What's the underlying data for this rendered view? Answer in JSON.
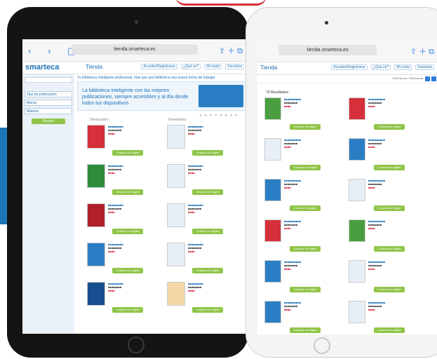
{
  "browser": {
    "url": "tienda.smarteca.es",
    "nav_glyphs": "‹ › ▢",
    "icons": [
      "reload-icon",
      "share-icon",
      "new-tab-icon",
      "tabs-icon"
    ]
  },
  "site": {
    "logo": "smarteca",
    "section": "Tienda",
    "head_links": [
      "Acceder/Registrarse",
      "¿Qué es?",
      "Mi cesta",
      "Favoritos"
    ],
    "tagline": "Tu biblioteca inteligente profesional, más que una biblioteca una nueva forma de trabajar"
  },
  "sidebar": {
    "filters": [
      "Tipo de publicación",
      "Marca",
      "Materia"
    ],
    "go_label": "Buscar"
  },
  "banner": {
    "text": "La biblioteca inteligente con las mejores publicaciones, siempre accesibles y al día desde todos tus dispositivos"
  },
  "columns": {
    "left": "Destacados",
    "right": "Novedades"
  },
  "buy_label": "Comprar en digital",
  "results_label": "74 Resultados :",
  "order_label": "Ordenar por: Relevancia",
  "colors": {
    "accent": "#1a6fb5",
    "buy": "#8fc548",
    "brand_red": "#d6303a"
  }
}
